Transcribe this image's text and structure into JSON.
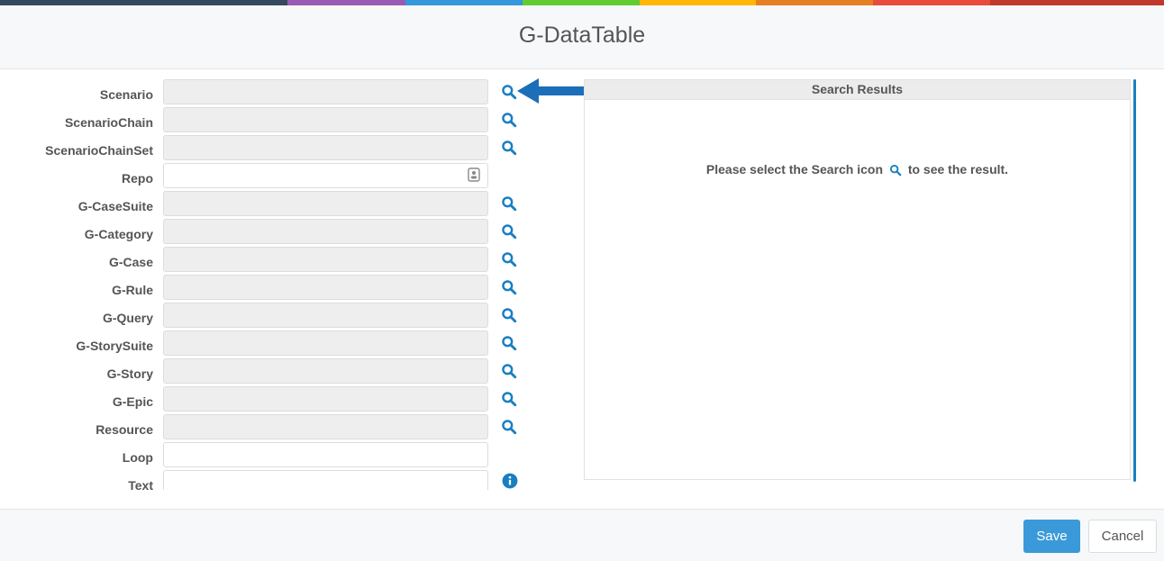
{
  "colors": {
    "strip": [
      "#34495e",
      "#9b59b6",
      "#3498db",
      "#62cb31",
      "#ffb606",
      "#e67e22",
      "#e74c3c",
      "#c0392b"
    ],
    "accent": "#1a7fc1",
    "primary_button": "#3a9ad9"
  },
  "header": {
    "title": "G-DataTable"
  },
  "form": {
    "rows": [
      {
        "label": "Scenario",
        "value": "",
        "icon": "search-icon"
      },
      {
        "label": "ScenarioChain",
        "value": "",
        "icon": "search-icon"
      },
      {
        "label": "ScenarioChainSet",
        "value": "",
        "icon": "search-icon"
      },
      {
        "label": "Repo",
        "value": "",
        "icon": "contact-card-icon"
      },
      {
        "label": "G-CaseSuite",
        "value": "",
        "icon": "search-icon"
      },
      {
        "label": "G-Category",
        "value": "",
        "icon": "search-icon"
      },
      {
        "label": "G-Case",
        "value": "",
        "icon": "search-icon"
      },
      {
        "label": "G-Rule",
        "value": "",
        "icon": "search-icon"
      },
      {
        "label": "G-Query",
        "value": "",
        "icon": "search-icon"
      },
      {
        "label": "G-StorySuite",
        "value": "",
        "icon": "search-icon"
      },
      {
        "label": "G-Story",
        "value": "",
        "icon": "search-icon"
      },
      {
        "label": "G-Epic",
        "value": "",
        "icon": "search-icon"
      },
      {
        "label": "Resource",
        "value": "",
        "icon": "search-icon"
      },
      {
        "label": "Loop",
        "value": ""
      },
      {
        "label": "Text",
        "value": "",
        "icon": "info-icon"
      }
    ]
  },
  "results": {
    "title": "Search Results",
    "message_before": "Please select the Search icon",
    "message_after": "to see the result."
  },
  "footer": {
    "save_label": "Save",
    "cancel_label": "Cancel"
  }
}
